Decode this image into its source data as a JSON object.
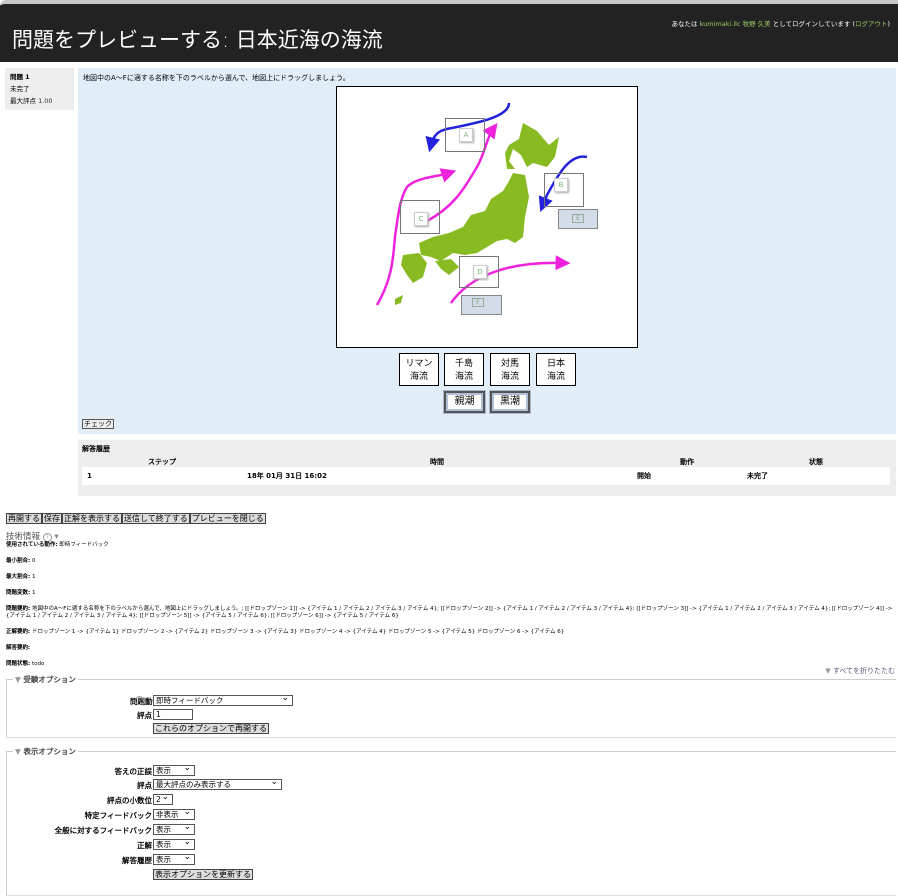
{
  "header": {
    "title": "問題をプレビューする: 日本近海の海流",
    "login_prefix": "あなたは ",
    "user": "kumimaki.llc 牧野 久美",
    "login_suffix": " としてログインしています (",
    "logout": "ログアウト",
    "login_close": ")"
  },
  "question_info": {
    "number_label": "問題",
    "number": "1",
    "status": "未完了",
    "max_grade_label": "最大評点",
    "max_grade": "1.00"
  },
  "question": {
    "text": "地図中のA～Fに適する名称を下のラベルから選んで、地図上にドラッグしましょう。",
    "drop_zones": [
      "A",
      "B",
      "C",
      "D",
      "E",
      "F"
    ],
    "drag_items": [
      "リマン\n海流",
      "千島\n海流",
      "対馬\n海流",
      "日本\n海流"
    ],
    "drag_items_2": [
      "親潮",
      "黒潮"
    ],
    "check_label": "チェック",
    "colors": {
      "warm_current": "#ee22dd",
      "cold_current": "#2222dd",
      "land": "#88bb22"
    }
  },
  "history": {
    "title": "解答履歴",
    "columns": [
      "ステップ",
      "時間",
      "動作",
      "状態"
    ],
    "rows": [
      [
        "1",
        "18年 01月 31日 16:02",
        "開始",
        "未完了"
      ]
    ]
  },
  "buttons": [
    "再開する",
    "保存",
    "正解を表示する",
    "送信して終了する",
    "プレビューを閉じる"
  ],
  "tech": {
    "title": "技術情報",
    "items": [
      {
        "k": "使用されている動作:",
        "v": " 即時フィードバック"
      },
      {
        "k": "最小割合:",
        "v": " 0"
      },
      {
        "k": "最大割合:",
        "v": " 1"
      },
      {
        "k": "問題変数:",
        "v": " 1"
      },
      {
        "k": "問題要約:",
        "v": " 地図中のA～Fに適する名称を下のラベルから選んで、地図上にドラッグしましょう。; [[ドロップゾーン 1]] -> {アイテム 1 / アイテム 2 / アイテム 3 / アイテム 4}; [[ドロップゾーン 2]] -> {アイテム 1 / アイテム 2 / アイテム 3 / アイテム 4}; [[ドロップゾーン 3]] -> {アイテム 1 / アイテム 2 / アイテム 3 / アイテム 4}; [[ドロップゾーン 4]] -> {アイテム 1 / アイテム 2 / アイテム 3 / アイテム 4}; [[ドロップゾーン 5]] -> {アイテム 5 / アイテム 6}; [[ドロップゾーン 6]] -> {アイテム 5 / アイテム 6}"
      },
      {
        "k": "正解要約:",
        "v": " ドロップゾーン 1 -> {アイテム 1} ドロップゾーン 2 -> {アイテム 2} ドロップゾーン 3 -> {アイテム 3} ドロップゾーン 4 -> {アイテム 4} ドロップゾーン 5 -> {アイテム 5} ドロップゾーン 6 -> {アイテム 6}"
      },
      {
        "k": "解答要約:",
        "v": ""
      },
      {
        "k": "問題状態:",
        "v": " todo"
      }
    ]
  },
  "collapse_all": "すべてを折りたたむ",
  "attempt_options": {
    "legend": "受験オプション",
    "behaviour_label": "問題動作",
    "behaviour": "即時フィードバック",
    "mark_label": "評点",
    "mark": "1",
    "restart_button": "これらのオプションで再開する"
  },
  "display_options": {
    "legend": "表示オプション",
    "rows": [
      {
        "label": "答えの正誤",
        "value": "表示"
      },
      {
        "label": "評点",
        "value": "最大評点のみ表示する"
      },
      {
        "label": "評点の小数位",
        "value": "2"
      },
      {
        "label": "特定フィードバック",
        "value": "非表示"
      },
      {
        "label": "全般に対するフィードバック",
        "value": "表示"
      },
      {
        "label": "正解",
        "value": "表示"
      },
      {
        "label": "解答履歴",
        "value": "表示"
      }
    ],
    "update_button": "表示オプションを更新する"
  }
}
